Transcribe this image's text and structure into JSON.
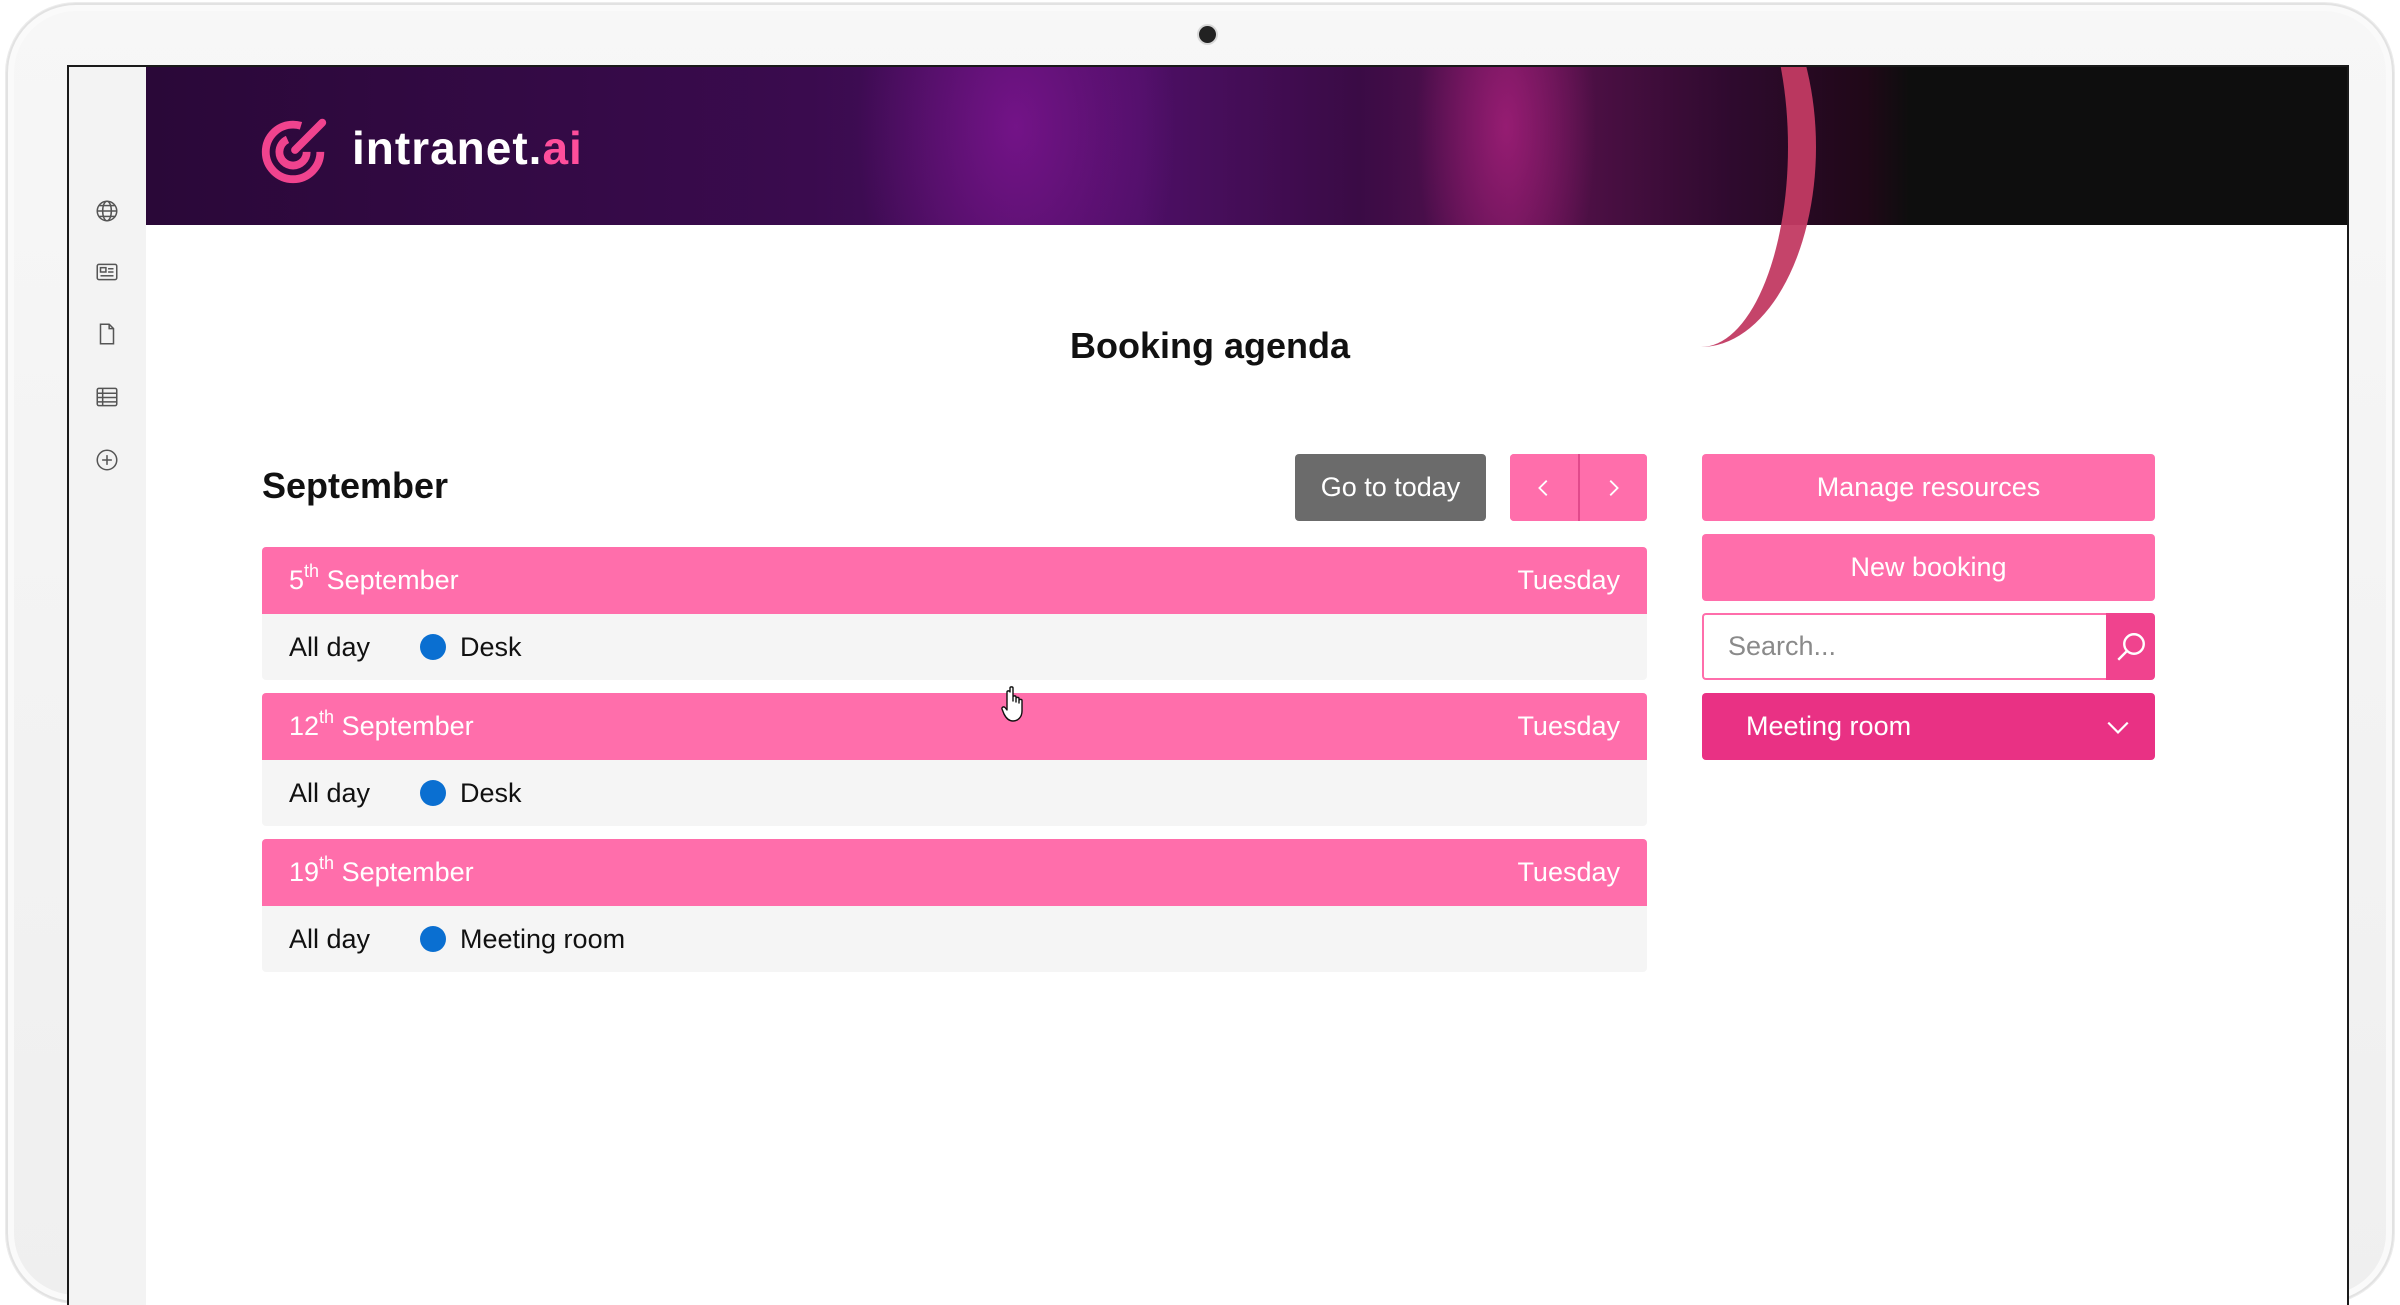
{
  "brand": {
    "name_main": "intranet.",
    "name_accent": "ai"
  },
  "page": {
    "title": "Booking agenda"
  },
  "sidebar": {
    "icons": [
      "globe-icon",
      "news-icon",
      "document-icon",
      "table-icon",
      "plus-circle-icon"
    ]
  },
  "agenda": {
    "month": "September",
    "go_to_today_label": "Go to today",
    "days": [
      {
        "day_num": "5",
        "suffix": "th",
        "month": "September",
        "weekday": "Tuesday",
        "time": "All day",
        "resource": "Desk"
      },
      {
        "day_num": "12",
        "suffix": "th",
        "month": "September",
        "weekday": "Tuesday",
        "time": "All day",
        "resource": "Desk"
      },
      {
        "day_num": "19",
        "suffix": "th",
        "month": "September",
        "weekday": "Tuesday",
        "time": "All day",
        "resource": "Meeting room"
      }
    ]
  },
  "actions": {
    "manage_resources_label": "Manage resources",
    "new_booking_label": "New booking",
    "search_placeholder": "Search...",
    "resource_filter_selected": "Meeting room"
  },
  "colors": {
    "accent_pink": "#ff6eab",
    "accent_dark_pink": "#e93184",
    "dot_blue": "#0a6fd1",
    "today_button_gray": "#6b6b6b"
  }
}
